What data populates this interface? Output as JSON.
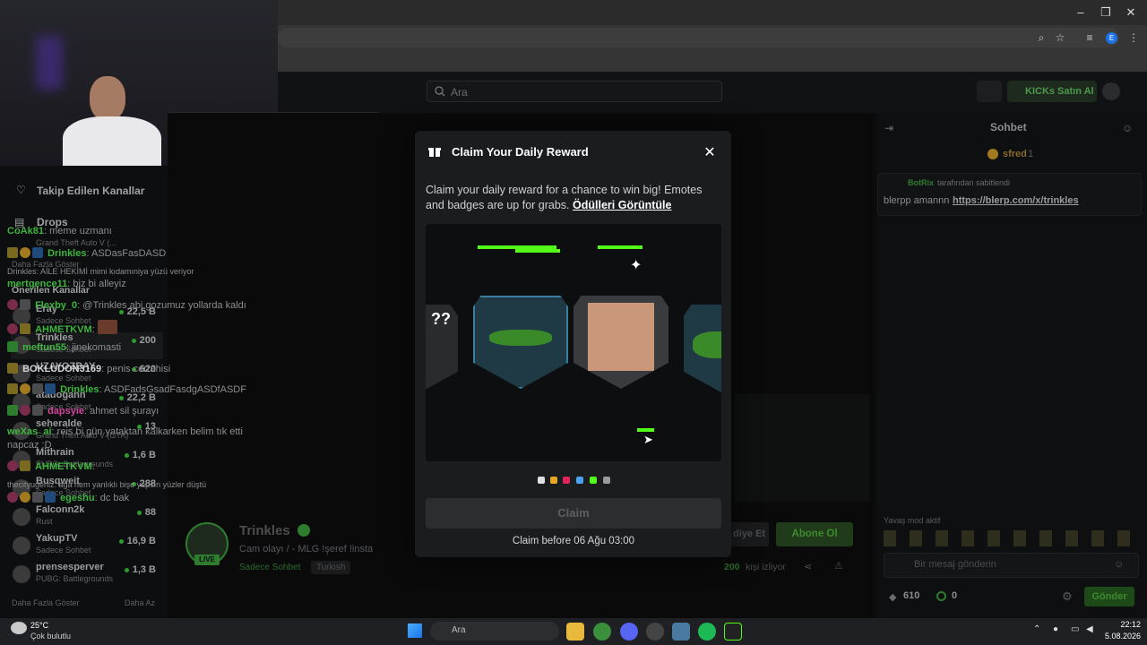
{
  "browser": {
    "window_controls": [
      "–",
      "❐",
      "✕"
    ],
    "profile_letter": "E"
  },
  "topbar": {
    "search_placeholder": "Ara",
    "kicks_button": "KICKs Satın Al"
  },
  "sidebar": {
    "following_label": "Takip Edilen Kanallar",
    "drops_label": "Drops",
    "drops_game": "Grand Theft Auto V (...",
    "show_more": "Daha Fazla Göster",
    "recommended_title": "Önerilen Kanallar",
    "channels": [
      {
        "name": "Eray",
        "sub": "Sadece Sohbet",
        "count": "22,5 B"
      },
      {
        "name": "Trinkles",
        "sub": "Sadece Sohbet",
        "count": "200"
      },
      {
        "name": "UZAYOZBAY",
        "sub": "Sadece Sohbet",
        "count": "620"
      },
      {
        "name": "atadogann",
        "sub": "Sadece Sohbet",
        "count": "22,2 B"
      },
      {
        "name": "seheralde",
        "sub": "Grand Theft Auto V (GTA)",
        "count": "13"
      },
      {
        "name": "Mithrain",
        "sub": "PUBG: Battlegrounds",
        "count": "1,6 B"
      },
      {
        "name": "Busqweit",
        "sub": "Sadece Sohbet",
        "count": "288"
      },
      {
        "name": "Falconn2k",
        "sub": "Rust",
        "count": "88"
      },
      {
        "name": "YakupTV",
        "sub": "Sadece Sohbet",
        "count": "16,9 B"
      },
      {
        "name": "prensesperver",
        "sub": "PUBG: Battlegrounds",
        "count": "1,3 B"
      }
    ],
    "show_more_bottom": "Daha Fazla Göster",
    "show_less": "Daha Az"
  },
  "streamer": {
    "name": "Trinkles",
    "live": "LIVE",
    "title": "Cam olayı / - MLG !şeref !insta",
    "category": "Sadece Sohbet",
    "language": "Turkish",
    "viewers_count": "200",
    "viewers_label": "kişi izliyor",
    "gift_button": "diye Et",
    "subscribe_button": "Abone Ol"
  },
  "chat": {
    "title": "Sohbet",
    "top_user": "sfred",
    "top_count": "1",
    "pinned_by": "BotRix",
    "pinned_label": "tarafından sabitlendi",
    "pinned_text": "blerpp amannn",
    "pinned_link": "https://blerp.com/x/trinkles",
    "messages": [
      {
        "user": "CoAk81",
        "text": "meme uzmanı",
        "color": "#3fb53f"
      },
      {
        "user": "Drinkles",
        "text": "ASDasFasDASD",
        "color": "#3fb53f"
      },
      {
        "user": "",
        "text": "Drinkles: AİLE HEKİMİ mimi kıdamıniya yüzü veriyor",
        "color": "#5a5c5e"
      },
      {
        "user": "mertgence11",
        "text": "biz bi alleyiz",
        "color": "#3fb53f"
      },
      {
        "user": "Flexby_0",
        "text": "@Trinkles abi gozumuz yollarda kaldı",
        "color": "#3fb53f"
      },
      {
        "user": "AHMETKVM",
        "text": "",
        "color": "#3fb53f"
      },
      {
        "user": "meftun55",
        "text": "jinekomasti",
        "color": "#3fb53f"
      },
      {
        "user": "BOKLUDON3169",
        "text": "penis cerrahisi",
        "color": "#d7d7d7"
      },
      {
        "user": "Drinkles",
        "text": "ASDFadsGsadFasdgASDfASDF",
        "color": "#3fb53f"
      },
      {
        "user": "dapsyie",
        "text": "ahmet sil şurayı",
        "color": "#d0449a"
      },
      {
        "user": "weXas_ai",
        "text": "reis bi gün yataktan kalkarken belim tık etti napcaz :D",
        "color": "#3fb53f"
      },
      {
        "user": "AHMETKVM",
        "text": "",
        "color": "#3fb53f"
      },
      {
        "user": "",
        "text": "thecityugeniz: aga hem yanlıklı bişe yapsın yüzler düştü",
        "color": "#5a5c5e"
      },
      {
        "user": "egeshu",
        "text": "dc bak",
        "color": "#3fb53f"
      }
    ],
    "slow_mode": "Yavaş mod aktif",
    "input_placeholder": "Bir mesaj gönderin",
    "kicks_count": "610",
    "points_count": "0",
    "send_button": "Gönder"
  },
  "modal": {
    "title": "Claim Your Daily Reward",
    "description": "Claim your daily reward for a chance to win big! Emotes and badges are up for grabs.",
    "link": "Ödülleri Görüntüle",
    "claim_button": "Claim",
    "claim_before": "Claim before 06 Ağu 03:00",
    "rarity_colors": [
      "#cccccc",
      "#e8a627",
      "#e0245e",
      "#4aa3f0",
      "#53fc18",
      "#9a9a9a"
    ]
  },
  "taskbar": {
    "weather_temp": "25°C",
    "weather_desc": "Çok bulutlu",
    "search_label": "Ara",
    "time": "22:12",
    "date": "5.08.2026"
  }
}
